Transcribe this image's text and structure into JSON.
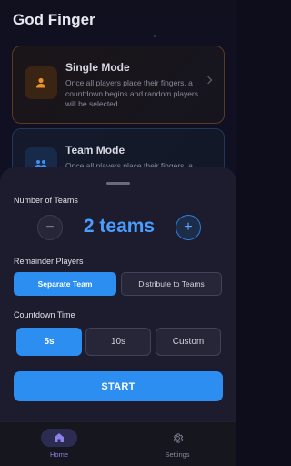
{
  "app": {
    "title": "God Finger"
  },
  "modes": [
    {
      "title": "Single Mode",
      "description": "Once all players place their fingers, a countdown begins and random players will be selected.",
      "icon": "person-icon"
    },
    {
      "title": "Team Mode",
      "description": "Once all players place their fingers, a",
      "icon": "group-icon"
    }
  ],
  "sheet": {
    "teams_label": "Number of Teams",
    "teams_value": "2 teams",
    "minus_label": "−",
    "plus_label": "+",
    "remainder_label": "Remainder Players",
    "remainder_options": [
      "Separate Team",
      "Distribute to Teams"
    ],
    "remainder_selected": "Separate Team",
    "countdown_label": "Countdown Time",
    "countdown_options": [
      "5s",
      "10s",
      "Custom"
    ],
    "countdown_selected": "5s",
    "start_label": "START"
  },
  "nav": {
    "items": [
      {
        "label": "Home",
        "icon": "home-icon",
        "active": true
      },
      {
        "label": "Settings",
        "icon": "gear-icon",
        "active": false
      }
    ]
  },
  "colors": {
    "accent": "#2b8ef0",
    "accent_text": "#4a9dff",
    "sheet_bg": "#1c1c2e",
    "nav_active": "#8a82e8"
  }
}
